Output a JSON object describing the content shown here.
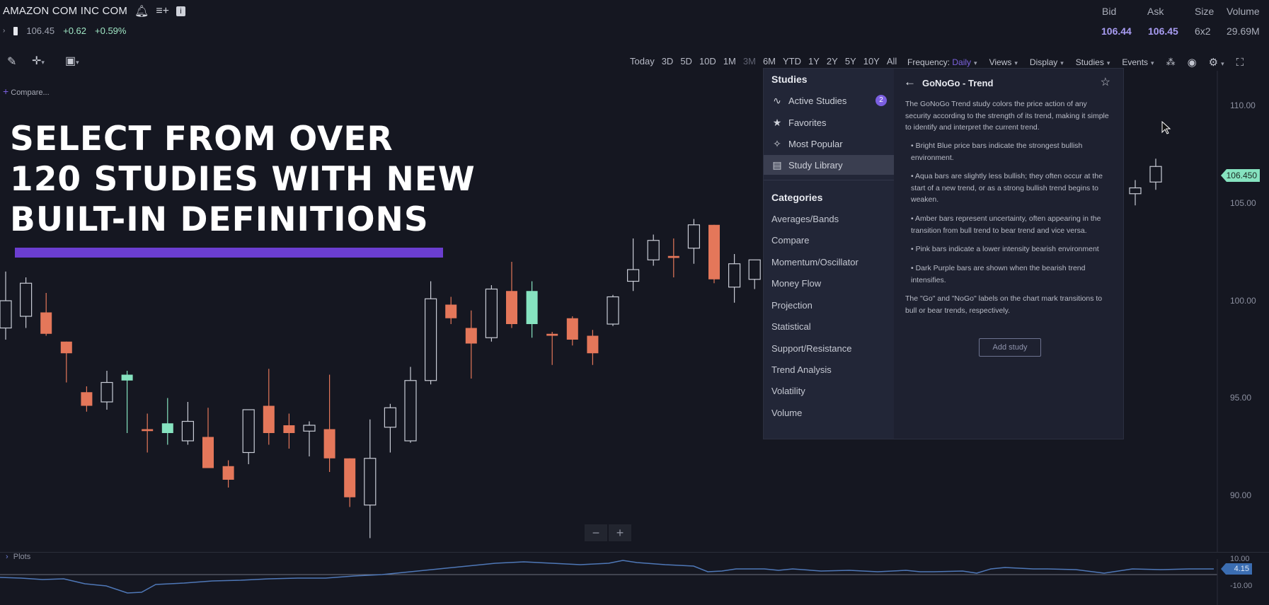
{
  "header": {
    "security_name": "AMAZON COM INC COM",
    "last_price": "106.45",
    "change": "+0.62",
    "change_pct": "+0.59%",
    "quote_headers": {
      "bid": "Bid",
      "ask": "Ask",
      "size": "Size",
      "volume": "Volume"
    },
    "quote_values": {
      "bid": "106.44",
      "ask": "106.45",
      "size": "6x2",
      "volume": "29.69M"
    },
    "colors": {
      "bid_ask": "#a89cf2",
      "change": "#9fe6c4"
    }
  },
  "toolbar": {
    "ranges": [
      "Today",
      "3D",
      "5D",
      "10D",
      "1M",
      "3M",
      "6M",
      "YTD",
      "1Y",
      "2Y",
      "5Y",
      "10Y",
      "All"
    ],
    "active_range": "3M",
    "frequency_label": "Frequency:",
    "frequency_value": "Daily",
    "views": "Views",
    "display": "Display",
    "studies": "Studies",
    "events": "Events"
  },
  "compare_label": "Compare...",
  "headline": [
    "SELECT FROM OVER",
    "120 STUDIES WITH NEW",
    "BUILT-IN DEFINITIONS"
  ],
  "studies_panel": {
    "title": "Studies",
    "nav": [
      {
        "label": "Active Studies",
        "icon": "wave-icon",
        "badge": "2"
      },
      {
        "label": "Favorites",
        "icon": "star-icon"
      },
      {
        "label": "Most Popular",
        "icon": "sparkle-icon"
      },
      {
        "label": "Study Library",
        "icon": "book-icon",
        "selected": true
      }
    ],
    "categories_title": "Categories",
    "categories": [
      "Averages/Bands",
      "Compare",
      "Momentum/Oscillator",
      "Money Flow",
      "Projection",
      "Statistical",
      "Support/Resistance",
      "Trend Analysis",
      "Volatility",
      "Volume"
    ],
    "detail": {
      "title": "GoNoGo - Trend",
      "intro": "The GoNoGo Trend study colors the price action of any security according to the strength of its trend, making it simple to identify and interpret the current trend.",
      "bullets": [
        "• Bright Blue price bars indicate the strongest bullish environment.",
        "• Aqua bars are slightly less bullish; they often occur at the start of a new trend, or as a strong bullish trend begins to weaken.",
        "• Amber bars represent uncertainty, often appearing in the transition from bull trend to bear trend and vice versa.",
        "• Pink bars indicate a lower intensity bearish environment",
        "• Dark Purple bars are shown when the bearish trend intensifies."
      ],
      "outro": "The \"Go\" and \"NoGo\" labels on the chart mark transitions to bull or bear trends, respectively.",
      "add_button": "Add study"
    }
  },
  "y_axis": [
    "110.00",
    "105.00",
    "100.00",
    "95.00",
    "90.00"
  ],
  "price_tag": "106.450",
  "zoom": {
    "minus": "−",
    "plus": "+"
  },
  "plots": {
    "label": "Plots",
    "axis_top": "10.00",
    "axis_bottom": "-10.00",
    "value_tag": "4.15"
  },
  "chart_data": {
    "type": "candlestick",
    "ylim": [
      88,
      112
    ],
    "colors": {
      "bear": "#e4775a",
      "bull_hollow": "#c9ccd6",
      "go": "#86e3c0"
    },
    "candles": [
      {
        "o": 100,
        "h": 101.5,
        "l": 98,
        "c": 98.6,
        "s": "hollow"
      },
      {
        "o": 99.2,
        "h": 101.2,
        "l": 98.6,
        "c": 100.9,
        "s": "hollow"
      },
      {
        "o": 99.4,
        "h": 100.4,
        "l": 98.2,
        "c": 98.3,
        "s": "bear"
      },
      {
        "o": 97.9,
        "h": 97.9,
        "l": 95.8,
        "c": 97.3,
        "s": "bear"
      },
      {
        "o": 95.3,
        "h": 95.6,
        "l": 94.3,
        "c": 94.6,
        "s": "bear"
      },
      {
        "o": 94.8,
        "h": 96.4,
        "l": 94.4,
        "c": 95.8,
        "s": "hollow"
      },
      {
        "o": 96.2,
        "h": 96.4,
        "l": 93.2,
        "c": 95.9,
        "s": "go"
      },
      {
        "o": 93.4,
        "h": 94.2,
        "l": 92.2,
        "c": 93.3,
        "s": "bear"
      },
      {
        "o": 93.2,
        "h": 95,
        "l": 92.6,
        "c": 93.7,
        "s": "go"
      },
      {
        "o": 92.8,
        "h": 94.8,
        "l": 92.6,
        "c": 93.8,
        "s": "hollow"
      },
      {
        "o": 93,
        "h": 94.5,
        "l": 91.4,
        "c": 91.4,
        "s": "bear"
      },
      {
        "o": 91.5,
        "h": 91.8,
        "l": 90.4,
        "c": 90.8,
        "s": "bear"
      },
      {
        "o": 92.2,
        "h": 94.4,
        "l": 91.6,
        "c": 94.4,
        "s": "hollow"
      },
      {
        "o": 94.6,
        "h": 96.5,
        "l": 92.6,
        "c": 93.2,
        "s": "bear"
      },
      {
        "o": 93.6,
        "h": 94.2,
        "l": 92.4,
        "c": 93.2,
        "s": "bear"
      },
      {
        "o": 93.6,
        "h": 93.8,
        "l": 92,
        "c": 93.3,
        "s": "hollow"
      },
      {
        "o": 93.4,
        "h": 96.2,
        "l": 91.2,
        "c": 91.9,
        "s": "bear"
      },
      {
        "o": 91.9,
        "h": 91.9,
        "l": 89.4,
        "c": 89.9,
        "s": "bear"
      },
      {
        "o": 89.5,
        "h": 93.9,
        "l": 87.8,
        "c": 91.9,
        "s": "hollow"
      },
      {
        "o": 93.5,
        "h": 94.7,
        "l": 92.2,
        "c": 94.5,
        "s": "hollow"
      },
      {
        "o": 92.8,
        "h": 96.6,
        "l": 92.7,
        "c": 95.9,
        "s": "hollow"
      },
      {
        "o": 95.9,
        "h": 101,
        "l": 95.7,
        "c": 100.1,
        "s": "hollow"
      },
      {
        "o": 99.8,
        "h": 100.2,
        "l": 98.8,
        "c": 99.1,
        "s": "bear"
      },
      {
        "o": 98.6,
        "h": 99.5,
        "l": 96,
        "c": 97.8,
        "s": "bear"
      },
      {
        "o": 98.1,
        "h": 100.8,
        "l": 97.9,
        "c": 100.6,
        "s": "hollow"
      },
      {
        "o": 100.5,
        "h": 102,
        "l": 98.6,
        "c": 98.8,
        "s": "bear"
      },
      {
        "o": 98.8,
        "h": 101,
        "l": 98.1,
        "c": 100.5,
        "s": "go"
      },
      {
        "o": 98.3,
        "h": 98.4,
        "l": 96.7,
        "c": 98.2,
        "s": "bear"
      },
      {
        "o": 99.1,
        "h": 99.2,
        "l": 97.7,
        "c": 98,
        "s": "bear"
      },
      {
        "o": 98.2,
        "h": 98.5,
        "l": 96.7,
        "c": 97.3,
        "s": "bear"
      },
      {
        "o": 98.8,
        "h": 100.3,
        "l": 98.7,
        "c": 100.2,
        "s": "hollow"
      },
      {
        "o": 101,
        "h": 103.2,
        "l": 100.5,
        "c": 101.6,
        "s": "hollow"
      },
      {
        "o": 102.1,
        "h": 103.4,
        "l": 101.8,
        "c": 103.1,
        "s": "hollow"
      },
      {
        "o": 102.3,
        "h": 103.2,
        "l": 101.2,
        "c": 102.2,
        "s": "bear"
      },
      {
        "o": 102.7,
        "h": 104.2,
        "l": 101.9,
        "c": 103.9,
        "s": "hollow"
      },
      {
        "o": 103.9,
        "h": 103.9,
        "l": 100.9,
        "c": 101.1,
        "s": "bear"
      },
      {
        "o": 100.7,
        "h": 102.4,
        "l": 99.9,
        "c": 101.9,
        "s": "hollow"
      },
      {
        "o": 101.1,
        "h": 102.1,
        "l": 100.6,
        "c": 102.1,
        "s": "hollow"
      },
      {
        "o": 105.5,
        "h": 106.2,
        "l": 104.9,
        "c": 105.8,
        "s": "hollow"
      },
      {
        "o": 106.1,
        "h": 107.3,
        "l": 105.7,
        "c": 106.9,
        "s": "hollow"
      }
    ]
  }
}
